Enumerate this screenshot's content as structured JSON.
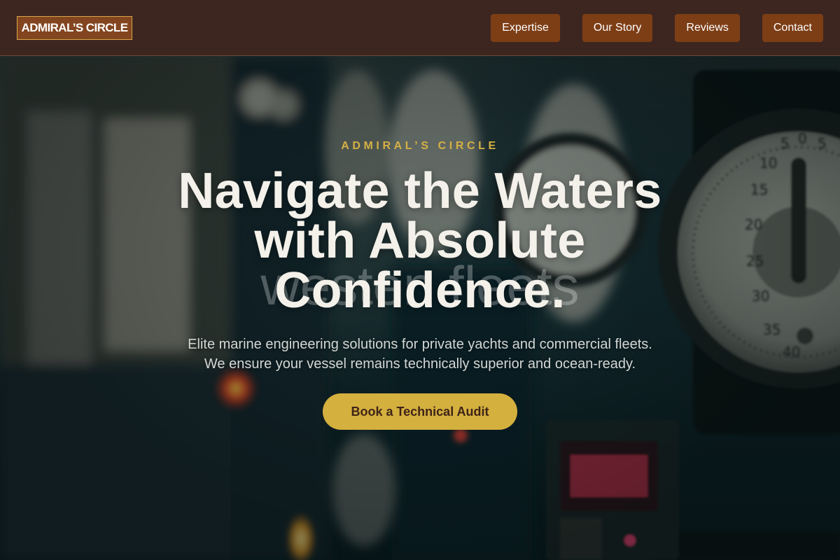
{
  "header": {
    "logo_text": "ADMIRAL’S CIRCLE",
    "nav": [
      {
        "label": "Expertise"
      },
      {
        "label": "Our Story"
      },
      {
        "label": "Reviews"
      },
      {
        "label": "Contact"
      }
    ]
  },
  "hero": {
    "eyebrow": "ADMIRAL’S CIRCLE",
    "headline": "Navigate the Waters with Absolute Confidence.",
    "ghost_text": "westen fleets",
    "subtitle_line1": "Elite marine engineering solutions for private yachts and commercial fleets.",
    "subtitle_line2": "We ensure your vessel remains technically superior and ocean-ready.",
    "cta_label": "Book a Technical Audit"
  },
  "colors": {
    "header_bg": "#3f2620",
    "nav_button": "#7d3e16",
    "logo_border": "#d4a84a",
    "accent_gold": "#d4b03e",
    "headline": "#f4f1ea"
  },
  "background": {
    "depicts": "gauge-panel-image",
    "gauge_ticks": [
      "5",
      "0",
      "5",
      "10",
      "15",
      "20",
      "25",
      "30",
      "35",
      "40"
    ]
  }
}
